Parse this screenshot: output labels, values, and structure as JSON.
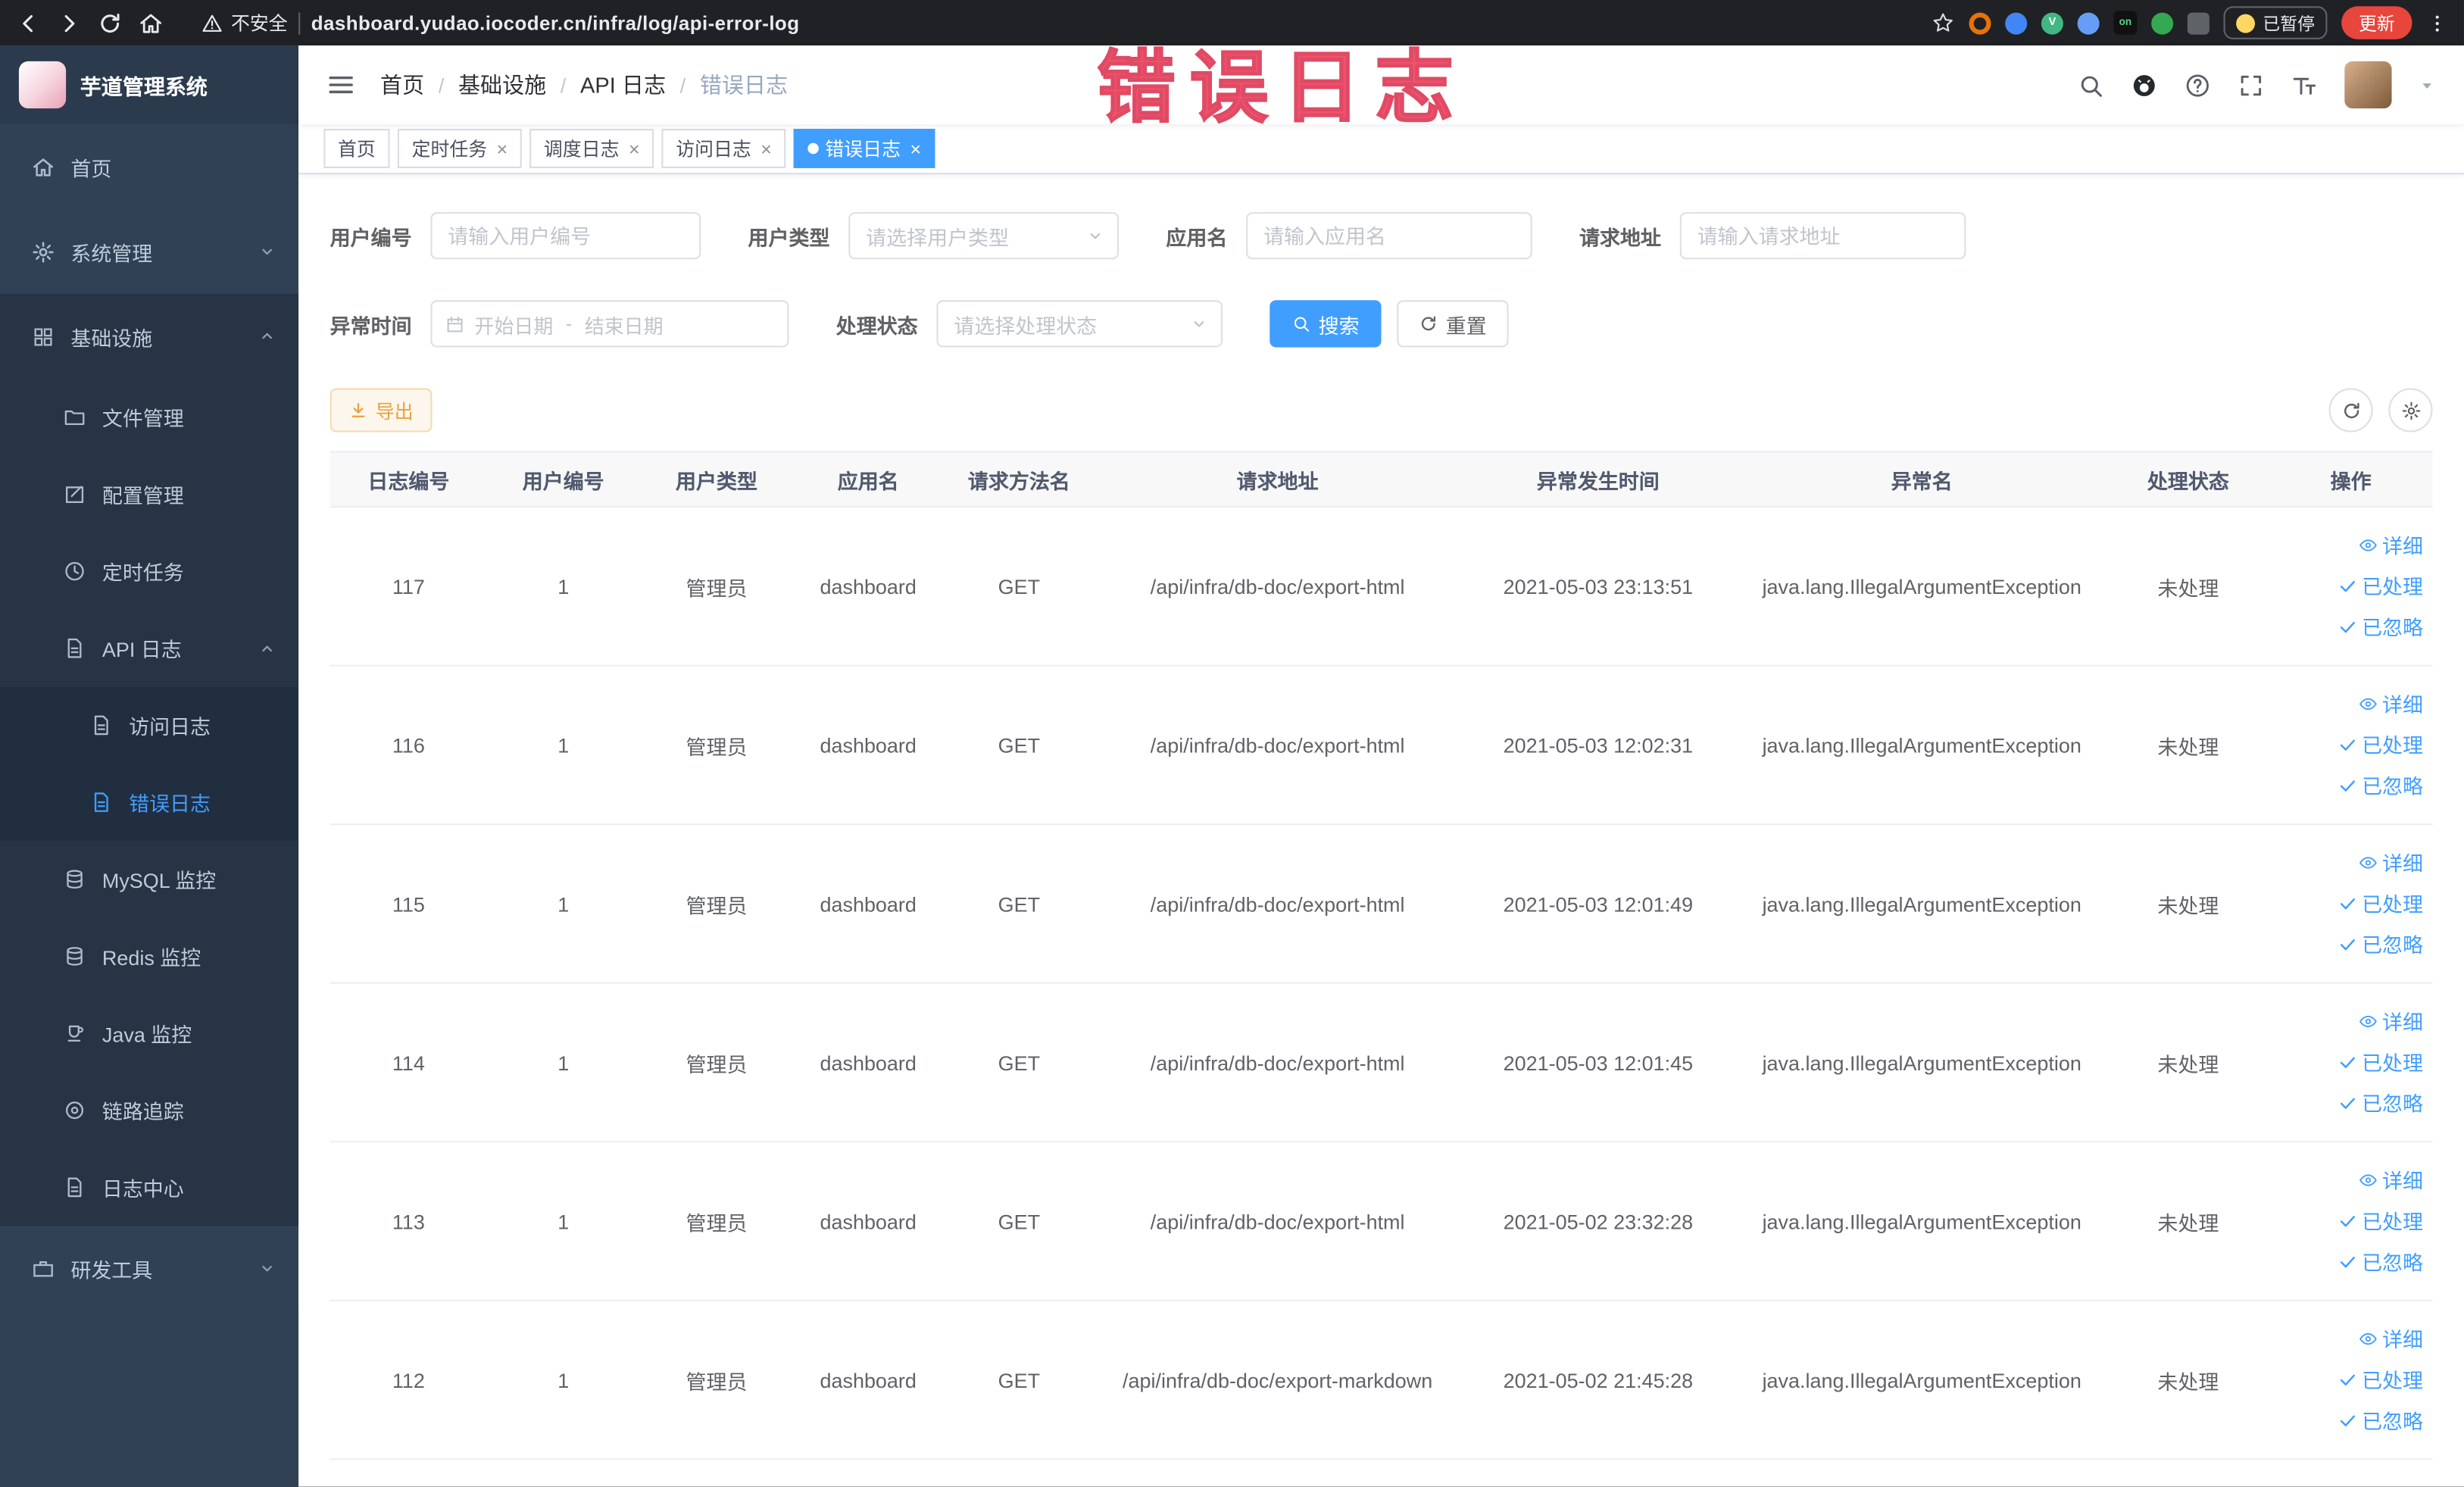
{
  "browser": {
    "security_label": "不安全",
    "url": "dashboard.yudao.iocoder.cn/infra/log/api-error-log",
    "paused_badge": "已暂停",
    "update_button": "更新",
    "ext_on_label": "on",
    "ext_vue_label": "V"
  },
  "annotation": "错误日志",
  "sidebar": {
    "title": "芋道管理系统",
    "home": "首页",
    "system": "系统管理",
    "infra": "基础设施",
    "file": "文件管理",
    "config": "配置管理",
    "job": "定时任务",
    "apilog": "API 日志",
    "access": "访问日志",
    "error": "错误日志",
    "mysql": "MySQL 监控",
    "redis": "Redis 监控",
    "java": "Java 监控",
    "trace": "链路追踪",
    "logcenter": "日志中心",
    "dev": "研发工具"
  },
  "breadcrumb": {
    "home": "首页",
    "infra": "基础设施",
    "apilog": "API 日志",
    "current": "错误日志"
  },
  "tabs": [
    {
      "label": "首页",
      "closable": false,
      "active": false
    },
    {
      "label": "定时任务",
      "closable": true,
      "active": false
    },
    {
      "label": "调度日志",
      "closable": true,
      "active": false
    },
    {
      "label": "访问日志",
      "closable": true,
      "active": false
    },
    {
      "label": "错误日志",
      "closable": true,
      "active": true
    }
  ],
  "ui": {
    "close": "×"
  },
  "filters": {
    "user_id": {
      "label": "用户编号",
      "placeholder": "请输入用户编号",
      "value": ""
    },
    "user_type": {
      "label": "用户类型",
      "placeholder": "请选择用户类型"
    },
    "app_name": {
      "label": "应用名",
      "placeholder": "请输入应用名",
      "value": ""
    },
    "request_url": {
      "label": "请求地址",
      "placeholder": "请输入请求地址",
      "value": ""
    },
    "exception_time": {
      "label": "异常时间",
      "start_placeholder": "开始日期",
      "separator": "-",
      "end_placeholder": "结束日期"
    },
    "process_status": {
      "label": "处理状态",
      "placeholder": "请选择处理状态"
    },
    "search_label": "搜索",
    "reset_label": "重置"
  },
  "toolbar": {
    "export_label": "导出"
  },
  "table": {
    "columns": [
      "日志编号",
      "用户编号",
      "用户类型",
      "应用名",
      "请求方法名",
      "请求地址",
      "异常发生时间",
      "异常名",
      "处理状态",
      "操作"
    ],
    "actions": {
      "detail": "详细",
      "processed": "已处理",
      "ignored": "已忽略"
    },
    "rows": [
      {
        "id": "117",
        "user_id": "1",
        "user_type": "管理员",
        "app": "dashboard",
        "method": "GET",
        "url": "/api/infra/db-doc/export-html",
        "time": "2021-05-03 23:13:51",
        "exception": "java.lang.IllegalArgumentException",
        "status": "未处理"
      },
      {
        "id": "116",
        "user_id": "1",
        "user_type": "管理员",
        "app": "dashboard",
        "method": "GET",
        "url": "/api/infra/db-doc/export-html",
        "time": "2021-05-03 12:02:31",
        "exception": "java.lang.IllegalArgumentException",
        "status": "未处理"
      },
      {
        "id": "115",
        "user_id": "1",
        "user_type": "管理员",
        "app": "dashboard",
        "method": "GET",
        "url": "/api/infra/db-doc/export-html",
        "time": "2021-05-03 12:01:49",
        "exception": "java.lang.IllegalArgumentException",
        "status": "未处理"
      },
      {
        "id": "114",
        "user_id": "1",
        "user_type": "管理员",
        "app": "dashboard",
        "method": "GET",
        "url": "/api/infra/db-doc/export-html",
        "time": "2021-05-03 12:01:45",
        "exception": "java.lang.IllegalArgumentException",
        "status": "未处理"
      },
      {
        "id": "113",
        "user_id": "1",
        "user_type": "管理员",
        "app": "dashboard",
        "method": "GET",
        "url": "/api/infra/db-doc/export-html",
        "time": "2021-05-02 23:32:28",
        "exception": "java.lang.IllegalArgumentException",
        "status": "未处理"
      },
      {
        "id": "112",
        "user_id": "1",
        "user_type": "管理员",
        "app": "dashboard",
        "method": "GET",
        "url": "/api/infra/db-doc/export-markdown",
        "time": "2021-05-02 21:45:28",
        "exception": "java.lang.IllegalArgumentException",
        "status": "未处理"
      }
    ]
  },
  "colors": {
    "accent": "#409EFF",
    "sidebar_bg": "#304156",
    "warning": "#E6A23C",
    "annotation": "#F0536E",
    "update_red": "#E8453C"
  }
}
